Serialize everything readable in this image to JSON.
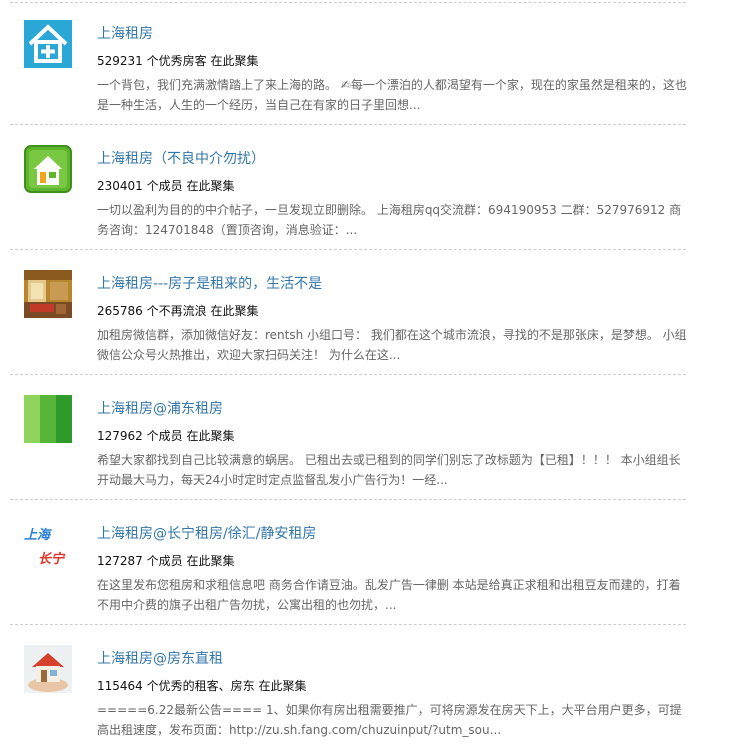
{
  "items": [
    {
      "title": "上海租房",
      "count": "529231 个优秀房客 在此聚集",
      "desc": "一个背包，我们充满激情踏上了来上海的路。 ✍每一个漂泊的人都渴望有一个家，现在的家虽然是租来的，这也是一种生活，人生的一个经历，当自己在有家的日子里回想..."
    },
    {
      "title": "上海租房（不良中介勿扰）",
      "count": "230401 个成员 在此聚集",
      "desc": "一切以盈利为目的的中介帖子，一旦发现立即删除。 上海租房qq交流群：694190953 二群：527976912 商务咨询：124701848（置顶咨询，消息验证：..."
    },
    {
      "title": "上海租房---房子是租来的，生活不是",
      "count": "265786 个不再流浪 在此聚集",
      "desc": "加租房微信群，添加微信好友：rentsh 小组口号： 我们都在这个城市流浪，寻找的不是那张床，是梦想。 小组微信公众号火热推出，欢迎大家扫码关注！ 为什么在这..."
    },
    {
      "title": "上海租房@浦东租房",
      "count": "127962 个成员 在此聚集",
      "desc": "希望大家都找到自己比较满意的蜗居。 已租出去或已租到的同学们别忘了改标题为【已租】！！！ 本小组组长开动最大马力，每天24小时定时定点监督乱发小广告行为！一经..."
    },
    {
      "title": "上海租房@长宁租房/徐汇/静安租房",
      "count": "127287 个成员 在此聚集",
      "desc": "在这里发布您租房和求租信息吧 商务合作请豆油。乱发广告一律删 本站是给真正求租和出租豆友而建的，打着不用中介费的旗子出租广告勿扰，公寓出租的也勿扰，...",
      "thumb_text": [
        "上海",
        "长宁"
      ]
    },
    {
      "title": "上海租房@房东直租",
      "count": "115464 个优秀的租客、房东 在此聚集",
      "desc": "=====6.22最新公告==== 1、如果你有房出租需要推广，可将房源发在房天下上，大平台用户更多，可提高出租速度，发布页面：http://zu.sh.fang.com/chuzuinput/?utm_sou..."
    }
  ]
}
